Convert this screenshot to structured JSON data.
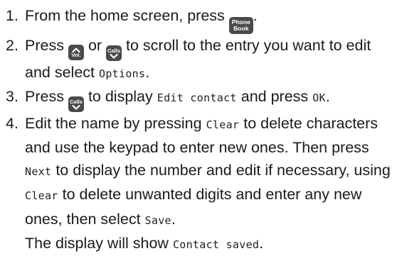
{
  "steps": [
    {
      "number": "1.",
      "text_1": "From the home screen, press",
      "key_phonebook": {
        "line1": "Phone",
        "line2": "Book",
        "icon": "phonebook-key-icon"
      },
      "text_2": "."
    },
    {
      "number": "2.",
      "text_1": "Press",
      "key_up": {
        "sub": "Vol.",
        "icon": "up-vol-key-icon"
      },
      "text_2": "or",
      "key_down": {
        "label": "Calls",
        "icon": "down-calls-key-icon"
      },
      "text_3": "to scroll to the entry you want to edit and select",
      "lcd_1": "Options",
      "text_4": "."
    },
    {
      "number": "3.",
      "text_1": "Press",
      "key_down": {
        "label": "Calls",
        "icon": "down-calls-key-icon"
      },
      "text_2": "to display",
      "lcd_1": "Edit contact",
      "text_3": "and press",
      "lcd_2": "OK",
      "text_4": "."
    },
    {
      "number": "4.",
      "text_1": "Edit the name by pressing",
      "lcd_1": "Clear",
      "text_2": "to delete characters and use the keypad to enter new ones. Then press",
      "lcd_2": "Next",
      "text_3": "to display the number and edit if necessary, using",
      "lcd_3": "Clear",
      "text_4": "to delete unwanted digits and enter any new ones, then select",
      "lcd_4": "Save",
      "text_5": ".",
      "text_6": "The display will show",
      "lcd_5": "Contact saved",
      "text_7": "."
    }
  ]
}
